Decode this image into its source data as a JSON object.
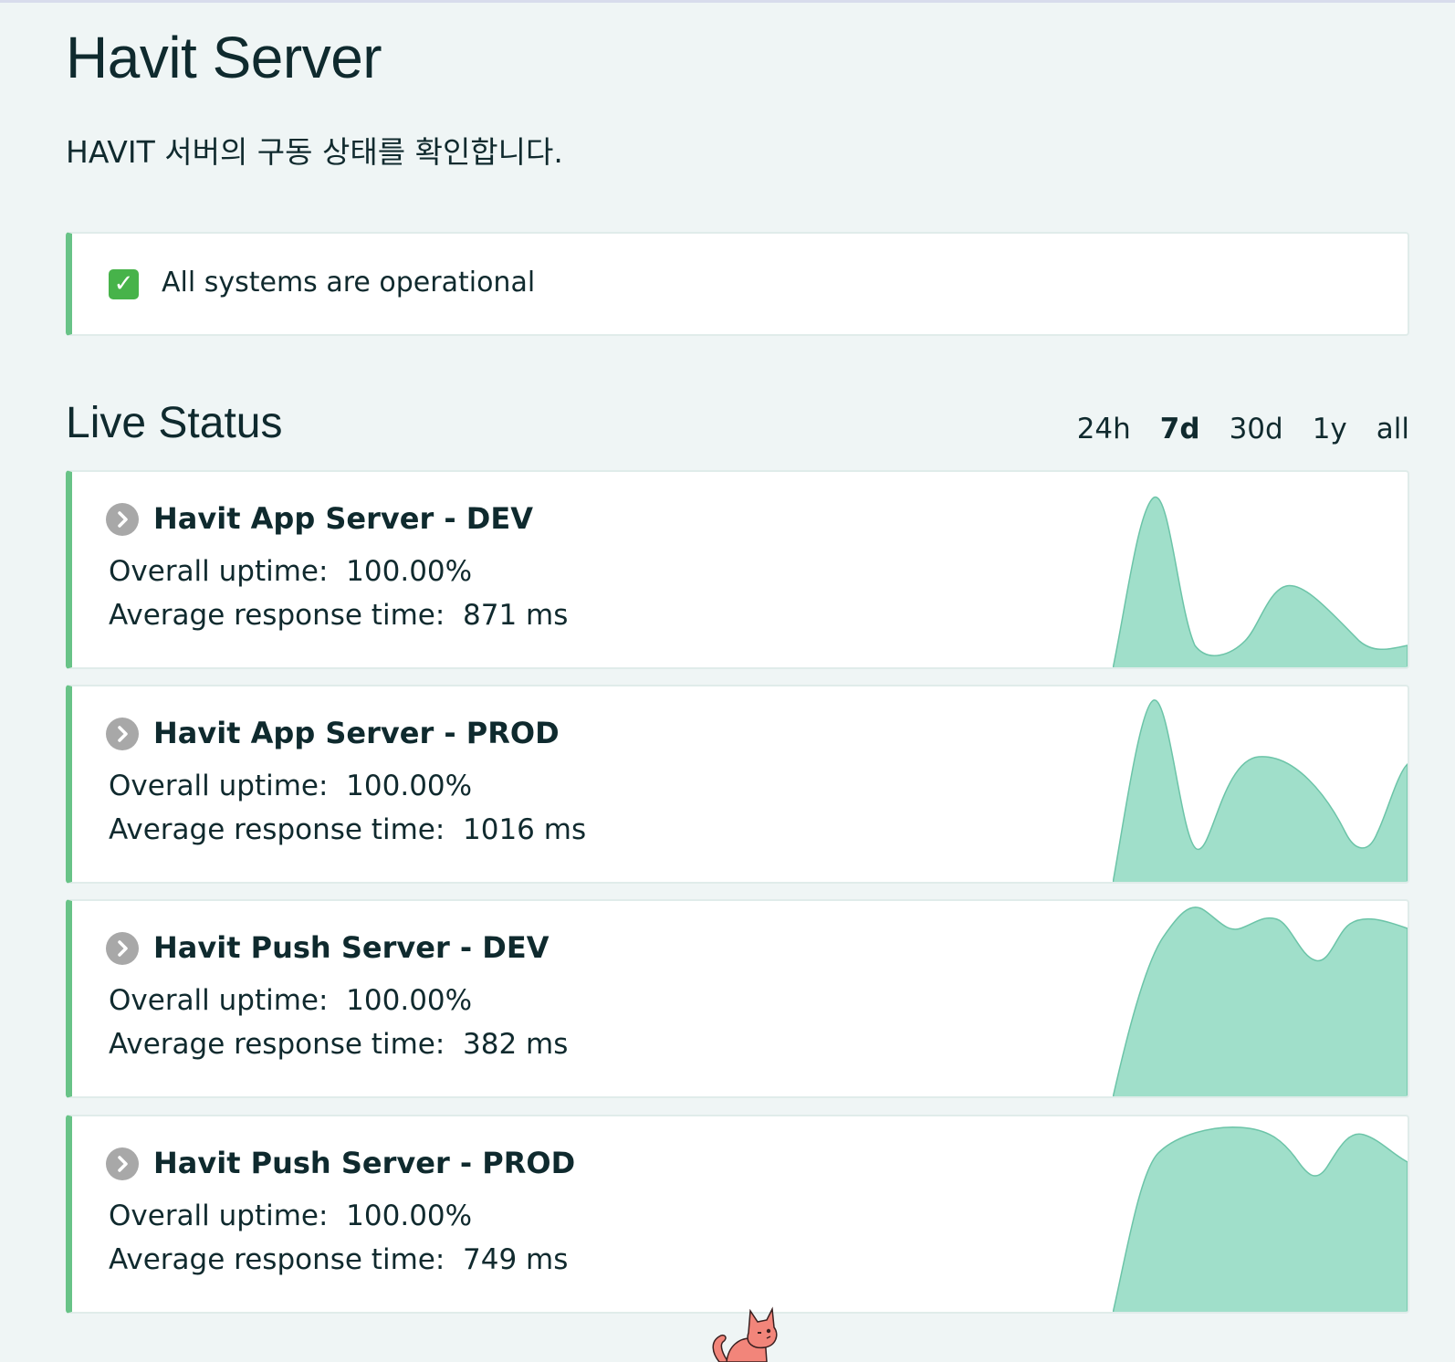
{
  "page": {
    "title": "Havit Server",
    "subtitle": "HAVIT 서버의 구동 상태를 확인합니다."
  },
  "banner": {
    "icon": "check-mark-icon",
    "text": "All systems are operational",
    "accent_color": "#68c387"
  },
  "live_status": {
    "title": "Live Status",
    "ranges": [
      "24h",
      "7d",
      "30d",
      "1y",
      "all"
    ],
    "active_range": "7d"
  },
  "labels": {
    "uptime": "Overall uptime:",
    "response": "Average response time:"
  },
  "services": [
    {
      "name": "Havit App Server - DEV",
      "uptime": "100.00%",
      "response": "871 ms"
    },
    {
      "name": "Havit App Server - PROD",
      "uptime": "100.00%",
      "response": "1016 ms"
    },
    {
      "name": "Havit Push Server - DEV",
      "uptime": "100.00%",
      "response": "382 ms"
    },
    {
      "name": "Havit Push Server - PROD",
      "uptime": "100.00%",
      "response": "749 ms"
    }
  ],
  "colors": {
    "background": "#eff5f5",
    "status_green": "#68c387",
    "sparkline_fill": "#a0dfca",
    "chevron_gray": "#a8a8a8"
  }
}
